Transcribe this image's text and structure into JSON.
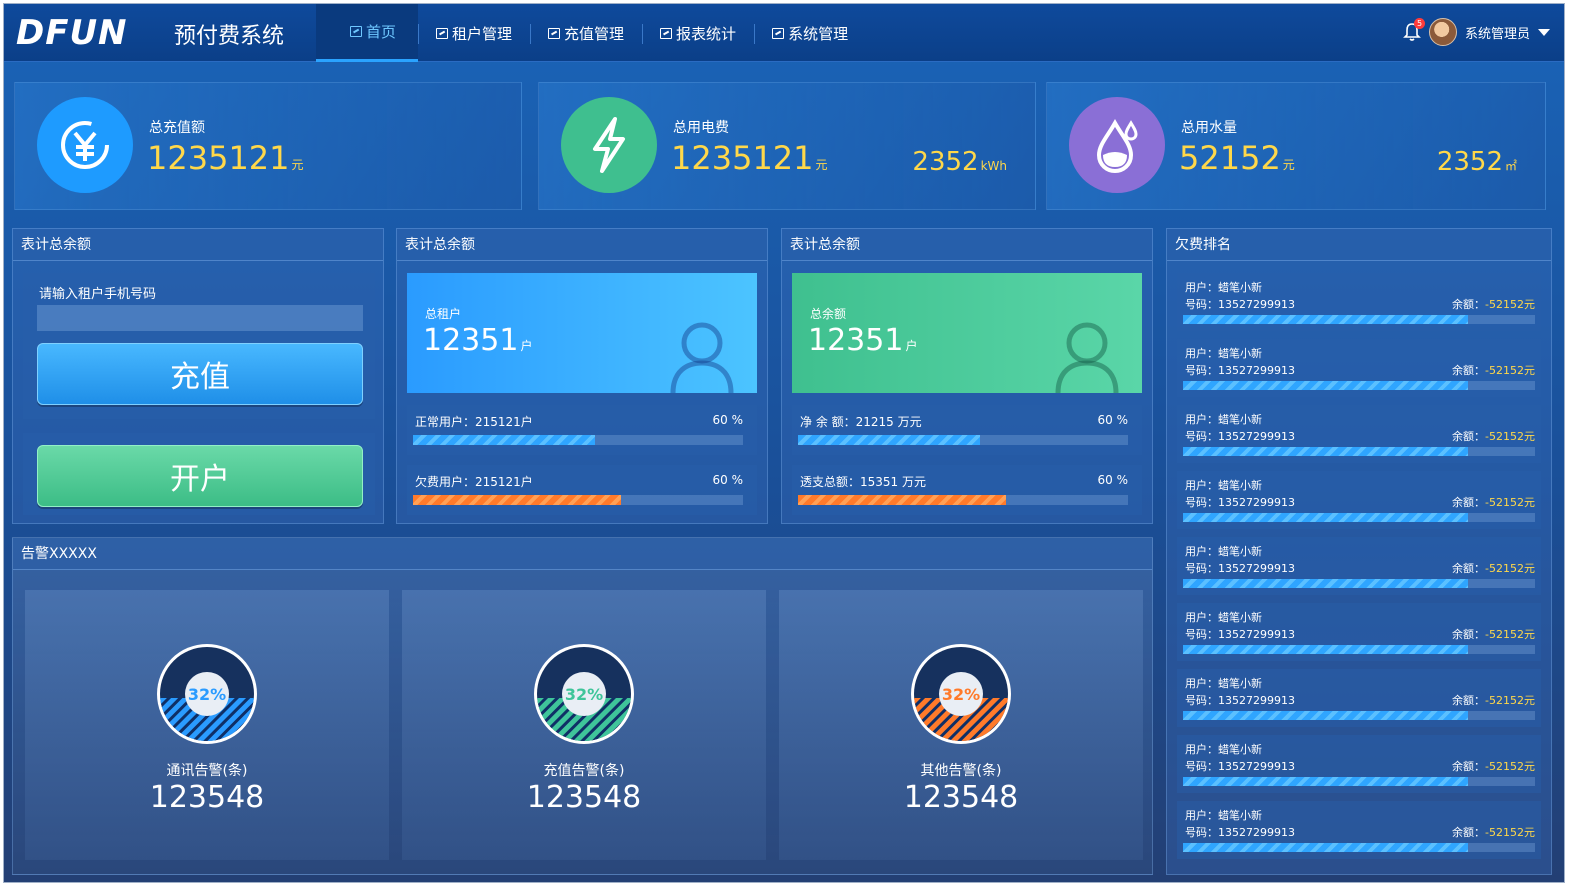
{
  "header": {
    "logo": "DFUN",
    "system_title": "预付费系统",
    "nav": [
      {
        "label": "首页",
        "active": true
      },
      {
        "label": "租户管理",
        "active": false
      },
      {
        "label": "充值管理",
        "active": false
      },
      {
        "label": "报表统计",
        "active": false
      },
      {
        "label": "系统管理",
        "active": false
      }
    ],
    "notification_count": "5",
    "user_name": "系统管理员"
  },
  "stats": [
    {
      "label": "总充值额",
      "value": "1235121",
      "unit": "元",
      "icon": "yuan-icon",
      "color": "#1e9bff"
    },
    {
      "label": "总用电费",
      "value": "1235121",
      "unit": "元",
      "right_value": "2352",
      "right_unit": "kWh",
      "icon": "lightning-icon",
      "color": "#3fbf8f"
    },
    {
      "label": "总用水量",
      "value": "52152",
      "unit": "元",
      "right_value": "2352",
      "right_unit": "㎡",
      "icon": "water-drop-icon",
      "color": "#8a6fd6"
    }
  ],
  "recharge_panel": {
    "title": "表计总余额",
    "phone_label": "请输入租户手机号码",
    "phone_value": "",
    "recharge_button": "充值",
    "open_account_button": "开户"
  },
  "tenant_panel": {
    "title": "表计总余额",
    "hero_label": "总租户",
    "hero_value": "12351",
    "hero_unit": "户",
    "rows": [
      {
        "label": "正常用户：215121户",
        "percent": "60 %",
        "fill": 0.55,
        "style": "blue"
      },
      {
        "label": "欠费用户：215121户",
        "percent": "60 %",
        "fill": 0.63,
        "style": "orange"
      }
    ]
  },
  "balance_panel": {
    "title": "表计总余额",
    "hero_label": "总余额",
    "hero_value": "12351",
    "hero_unit": "户",
    "rows": [
      {
        "label": "净 余 额：21215 万元",
        "percent": "60 %",
        "fill": 0.55,
        "style": "blue"
      },
      {
        "label": "透支总额：15351 万元",
        "percent": "60 %",
        "fill": 0.63,
        "style": "orange"
      }
    ]
  },
  "alarm_panel": {
    "title": "告警XXXXX",
    "items": [
      {
        "label": "通讯告警(条)",
        "value": "123548",
        "percent": "32%",
        "color": "#2a9bff"
      },
      {
        "label": "充值告警(条)",
        "value": "123548",
        "percent": "32%",
        "color": "#3fc59a"
      },
      {
        "label": "其他告警(条)",
        "value": "123548",
        "percent": "32%",
        "color": "#ff7a2a"
      }
    ]
  },
  "ranking_panel": {
    "title": "欠费排名",
    "items": [
      {
        "user": "用户：蜡笔小新",
        "phone": "号码：13527299913",
        "balance_label": "余额：",
        "balance": "-52152元",
        "fill": 0.81
      },
      {
        "user": "用户：蜡笔小新",
        "phone": "号码：13527299913",
        "balance_label": "余额：",
        "balance": "-52152元",
        "fill": 0.81
      },
      {
        "user": "用户：蜡笔小新",
        "phone": "号码：13527299913",
        "balance_label": "余额：",
        "balance": "-52152元",
        "fill": 0.81
      },
      {
        "user": "用户：蜡笔小新",
        "phone": "号码：13527299913",
        "balance_label": "余额：",
        "balance": "-52152元",
        "fill": 0.81
      },
      {
        "user": "用户：蜡笔小新",
        "phone": "号码：13527299913",
        "balance_label": "余额：",
        "balance": "-52152元",
        "fill": 0.81
      },
      {
        "user": "用户：蜡笔小新",
        "phone": "号码：13527299913",
        "balance_label": "余额：",
        "balance": "-52152元",
        "fill": 0.81
      },
      {
        "user": "用户：蜡笔小新",
        "phone": "号码：13527299913",
        "balance_label": "余额：",
        "balance": "-52152元",
        "fill": 0.81
      },
      {
        "user": "用户：蜡笔小新",
        "phone": "号码：13527299913",
        "balance_label": "余额：",
        "balance": "-52152元",
        "fill": 0.81
      },
      {
        "user": "用户：蜡笔小新",
        "phone": "号码：13527299913",
        "balance_label": "余额：",
        "balance": "-52152元",
        "fill": 0.81
      }
    ]
  }
}
